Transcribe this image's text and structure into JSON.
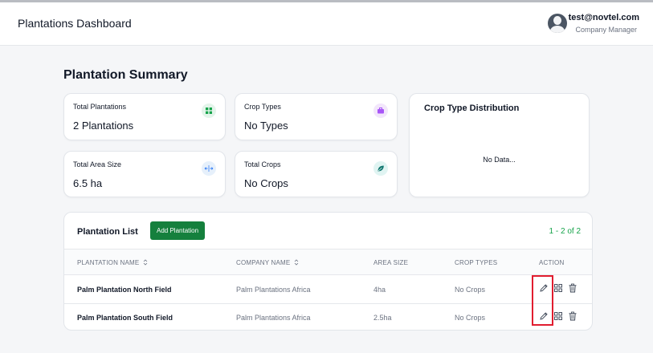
{
  "header": {
    "title": "Plantations Dashboard",
    "user_email": "test@novtel.com",
    "user_role": "Company Manager"
  },
  "summary": {
    "title": "Plantation Summary",
    "cards": [
      {
        "label": "Total Plantations",
        "value": "2 Plantations",
        "icon": "grid-icon",
        "color": "#16a34a"
      },
      {
        "label": "Crop Types",
        "value": "No Types",
        "icon": "briefcase-icon",
        "color": "#a855f7"
      },
      {
        "label": "Total Area Size",
        "value": "6.5 ha",
        "icon": "expand-horizontal-icon",
        "color": "#3b82f6"
      },
      {
        "label": "Total Crops",
        "value": "No Crops",
        "icon": "leaf-icon",
        "color": "#0f766e"
      }
    ],
    "distribution": {
      "title": "Crop Type Distribution",
      "empty_text": "No Data..."
    }
  },
  "list": {
    "title": "Plantation List",
    "add_label": "Add Plantation",
    "pager": "1 - 2 of 2",
    "columns": [
      "PLANTATION NAME",
      "COMPANY NAME",
      "AREA SIZE",
      "CROP TYPES",
      "ACTION"
    ],
    "rows": [
      {
        "name": "Palm Plantation North Field",
        "company": "Palm Plantations Africa",
        "area": "4ha",
        "crops": "No Crops"
      },
      {
        "name": "Palm Plantation South Field",
        "company": "Palm Plantations Africa",
        "area": "2.5ha",
        "crops": "No Crops"
      }
    ]
  },
  "colors": {
    "accent": "#15803d",
    "pager": "#16a34a",
    "highlight": "#e11d2f"
  }
}
